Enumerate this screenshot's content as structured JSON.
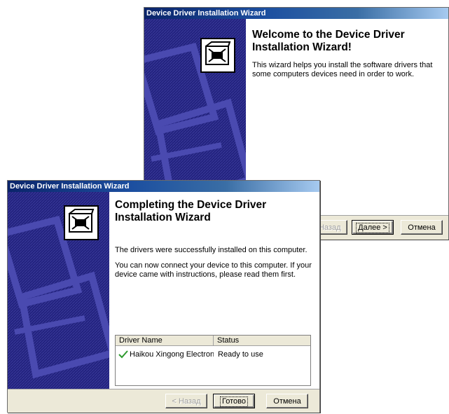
{
  "welcome_window": {
    "title": "Device Driver Installation Wizard",
    "heading": "Welcome to the Device Driver Installation Wizard!",
    "description": "This wizard helps you install the software drivers that some computers devices need in order to work.",
    "buttons": {
      "back": "< Назад",
      "next": "Далее >",
      "cancel": "Отмена"
    }
  },
  "completing_window": {
    "title": "Device Driver Installation Wizard",
    "heading": "Completing the Device Driver Installation Wizard",
    "success_text": "The drivers were successfully installed on this computer.",
    "instructions_text": "You can now connect your device to this computer. If your device came with instructions, please read them first.",
    "table": {
      "columns": [
        "Driver Name",
        "Status"
      ],
      "rows": [
        {
          "name": "Haikou Xingong Electron...",
          "status": "Ready to use",
          "icon": "green-check-icon"
        }
      ]
    },
    "buttons": {
      "back": "< Назад",
      "finish": "Готово",
      "cancel": "Отмена"
    }
  },
  "colors": {
    "title_bar": "#0a246a",
    "sidebar": "#20207a",
    "check": "#2e9a2e"
  }
}
